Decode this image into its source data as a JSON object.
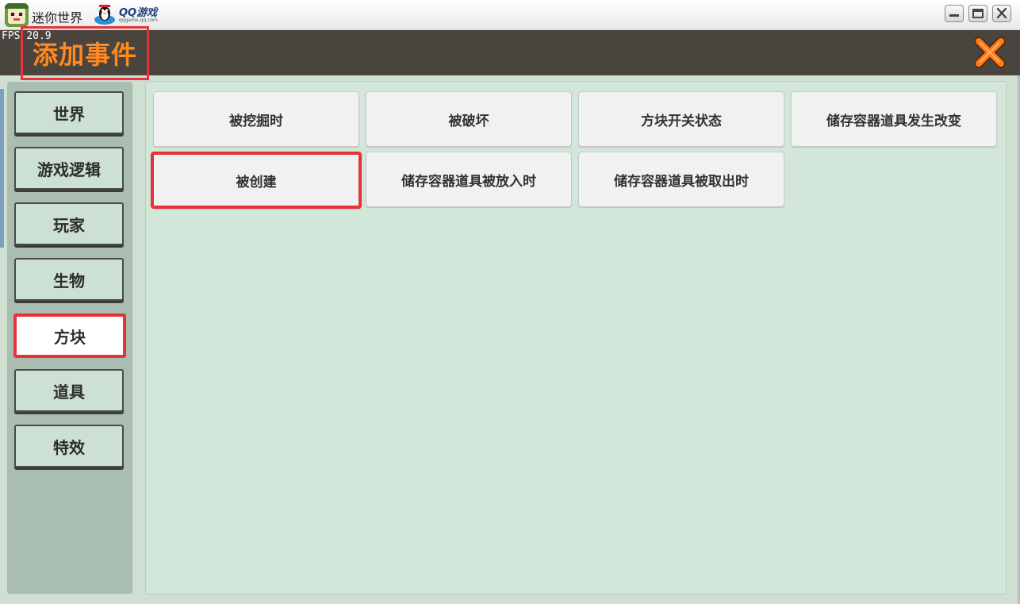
{
  "window": {
    "title": "迷你世界",
    "qq_brand": "QQ游戏",
    "qq_domain": "qqgame.qq.com",
    "fps_label": "FPS",
    "fps_value": "20.9"
  },
  "dialog": {
    "title": "添加事件"
  },
  "categories": [
    {
      "label": "世界",
      "selected": false
    },
    {
      "label": "游戏逻辑",
      "selected": false
    },
    {
      "label": "玩家",
      "selected": false
    },
    {
      "label": "生物",
      "selected": false
    },
    {
      "label": "方块",
      "selected": true
    },
    {
      "label": "道具",
      "selected": false
    },
    {
      "label": "特效",
      "selected": false
    }
  ],
  "events": [
    {
      "label": "被挖掘时",
      "highlighted": false
    },
    {
      "label": "被破坏",
      "highlighted": false
    },
    {
      "label": "方块开关状态",
      "highlighted": false
    },
    {
      "label": "储存容器道具发生改变",
      "highlighted": false
    },
    {
      "label": "被创建",
      "highlighted": true
    },
    {
      "label": "储存容器道具被放入时",
      "highlighted": false
    },
    {
      "label": "储存容器道具被取出时",
      "highlighted": false
    }
  ],
  "colors": {
    "header_bg": "#4a443e",
    "title_orange": "#ff8a1f",
    "highlight_red": "#e8323a",
    "panel_green": "#d2e6da",
    "sidebar_green": "#a9bdb0"
  },
  "icons": {
    "app": "mini-world-app-icon",
    "qq": "qq-penguin-icon",
    "minimize": "minimize-icon",
    "maximize": "maximize-icon",
    "close_window": "close-window-icon",
    "close_dialog": "close-x-icon"
  }
}
